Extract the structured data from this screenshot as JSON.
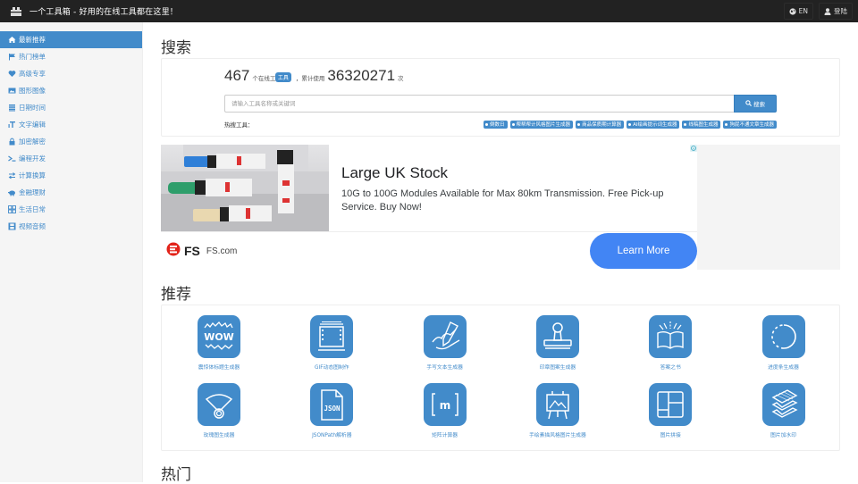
{
  "header": {
    "title": "一个工具箱 - 好用的在线工具都在这里！",
    "lang_button": "EN",
    "login_button": "登陆"
  },
  "sidebar": {
    "items": [
      {
        "label": "最新推荐",
        "icon": "home-icon",
        "active": true
      },
      {
        "label": "热门榜单",
        "icon": "flag-icon"
      },
      {
        "label": "高级专享",
        "icon": "heart-icon"
      },
      {
        "label": "图形图像",
        "icon": "image-icon"
      },
      {
        "label": "日期时间",
        "icon": "list-icon"
      },
      {
        "label": "文字编辑",
        "icon": "text-icon"
      },
      {
        "label": "加密解密",
        "icon": "lock-icon"
      },
      {
        "label": "编程开发",
        "icon": "terminal-icon"
      },
      {
        "label": "计算换算",
        "icon": "exchange-icon"
      },
      {
        "label": "金融理财",
        "icon": "piggy-bank-icon"
      },
      {
        "label": "生活日常",
        "icon": "grid-icon"
      },
      {
        "label": "视频音频",
        "icon": "film-icon"
      }
    ]
  },
  "search": {
    "section_title": "搜索",
    "tool_count": "467",
    "tool_count_suffix": "个在线工具",
    "tooltip": "工具",
    "usage_prefix": "，累计使用",
    "usage_count": "36320271",
    "usage_suffix": "次",
    "placeholder": "请输入工具名称或关键词",
    "button_label": "搜索",
    "hot_label": "热搜工具：",
    "hot_tags": [
      "倒数日",
      "帮帮帮计风格图片生成器",
      "商品保质期计算器",
      "AI绘画提示词生成器",
      "线稿图生成器",
      "狗屁不通文章生成器"
    ]
  },
  "ad": {
    "headline": "Large UK Stock",
    "description": "10G to 100G Modules Available for Max 80km Transmission. Free Pick-up Service. Buy Now!",
    "brand": "FS",
    "domain": "FS.com",
    "cta": "Learn More",
    "colors": {
      "cta": "#4285f4",
      "brand_red": "#e2231a"
    }
  },
  "recommend": {
    "section_title": "推荐",
    "tools": [
      {
        "label": "震惊体标题生成器",
        "icon": "wow-burst-icon"
      },
      {
        "label": "GIF动态图制作",
        "icon": "film-strip-icon"
      },
      {
        "label": "手写文本生成器",
        "icon": "handwriting-icon"
      },
      {
        "label": "印章图案生成器",
        "icon": "stamp-icon"
      },
      {
        "label": "答案之书",
        "icon": "open-book-icon"
      },
      {
        "label": "进度条生成器",
        "icon": "progress-circle-icon"
      },
      {
        "label": "玫瑰图生成器",
        "icon": "rose-chart-icon"
      },
      {
        "label": "JSONPath解析器",
        "icon": "json-file-icon"
      },
      {
        "label": "矩阵计算器",
        "icon": "matrix-icon"
      },
      {
        "label": "手绘素描风格图片生成器",
        "icon": "easel-icon"
      },
      {
        "label": "图片拼接",
        "icon": "collage-icon"
      },
      {
        "label": "图片加水印",
        "icon": "layers-icon"
      }
    ]
  },
  "hot": {
    "section_title": "热门"
  },
  "colors": {
    "primary": "#428bca",
    "topbar": "#222222",
    "sidebar_bg": "#f5f5f5"
  }
}
